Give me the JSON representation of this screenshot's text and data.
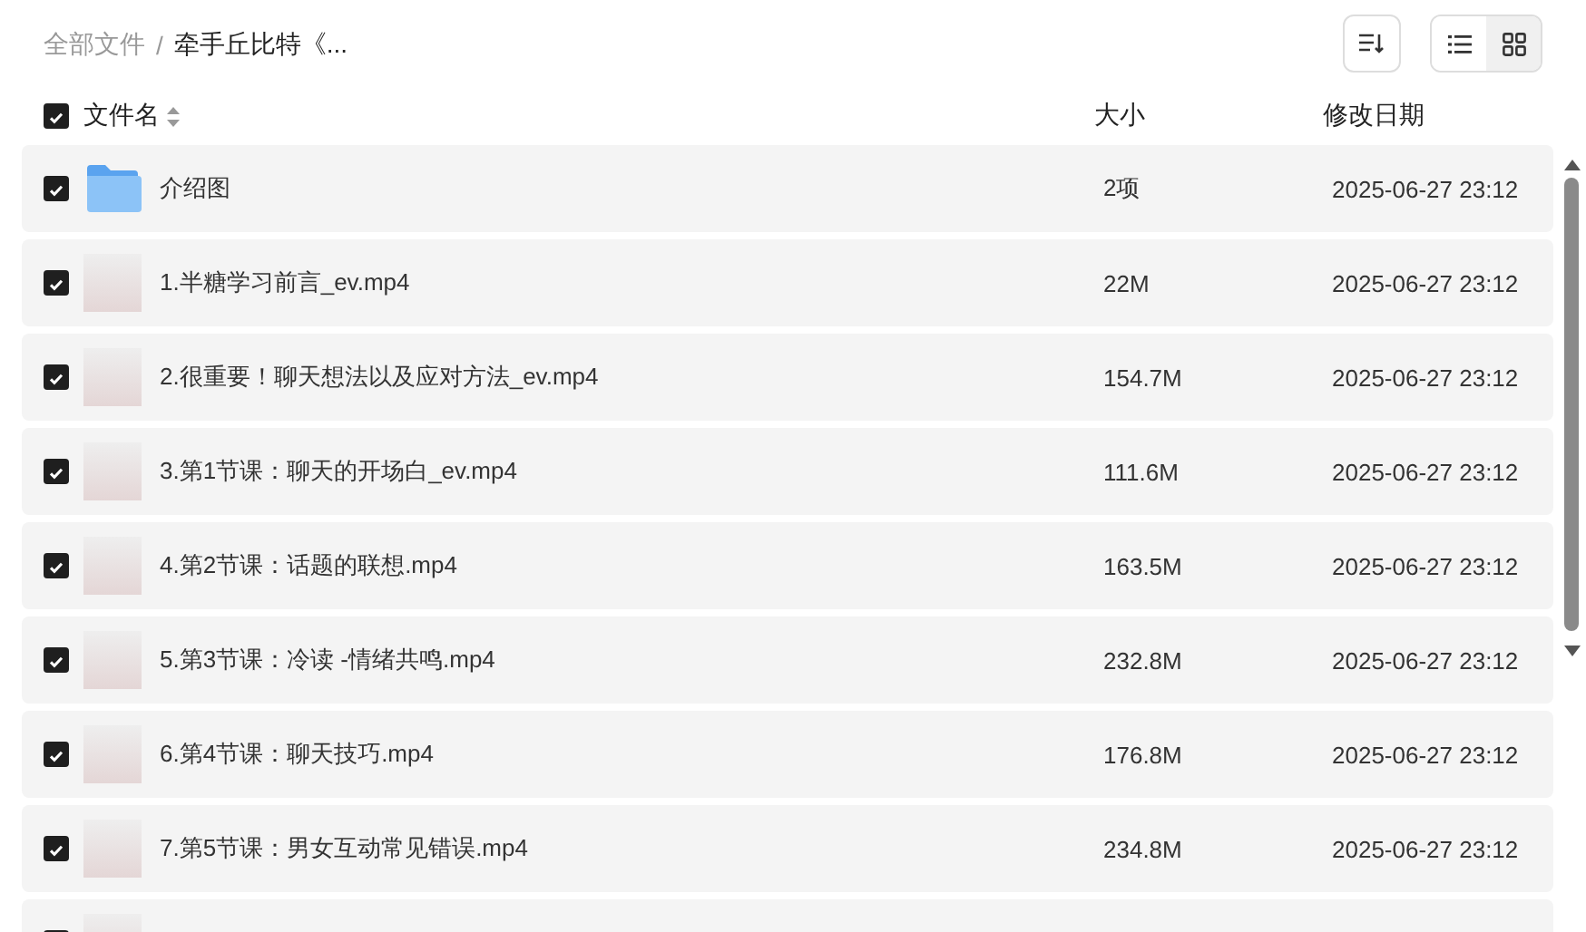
{
  "breadcrumb_separator": "/",
  "breadcrumb": [
    {
      "label": "全部文件",
      "current": false
    },
    {
      "label": "牵手丘比特《...",
      "current": true
    }
  ],
  "view_modes": [
    {
      "kind": "list",
      "selected": true
    },
    {
      "kind": "grid",
      "selected": false
    }
  ],
  "header": {
    "select_all_checked": true,
    "columns": [
      "文件名",
      "大小",
      "修改日期"
    ]
  },
  "files": [
    {
      "kind": "folder",
      "checked": true,
      "name": "介绍图",
      "size": "2项",
      "modified": "2025-06-27 23:12"
    },
    {
      "kind": "video",
      "checked": true,
      "name": "1.半糖学习前言_ev.mp4",
      "size": "22M",
      "modified": "2025-06-27 23:12"
    },
    {
      "kind": "video",
      "checked": true,
      "name": "2.很重要！聊天想法以及应对方法_ev.mp4",
      "size": "154.7M",
      "modified": "2025-06-27 23:12"
    },
    {
      "kind": "video",
      "checked": true,
      "name": "3.第1节课：聊天的开场白_ev.mp4",
      "size": "111.6M",
      "modified": "2025-06-27 23:12"
    },
    {
      "kind": "video",
      "checked": true,
      "name": "4.第2节课：话题的联想.mp4",
      "size": "163.5M",
      "modified": "2025-06-27 23:12"
    },
    {
      "kind": "video",
      "checked": true,
      "name": "5.第3节课：冷读 -情绪共鸣.mp4",
      "size": "232.8M",
      "modified": "2025-06-27 23:12"
    },
    {
      "kind": "video",
      "checked": true,
      "name": "6.第4节课：聊天技巧.mp4",
      "size": "176.8M",
      "modified": "2025-06-27 23:12"
    },
    {
      "kind": "video",
      "checked": true,
      "name": "7.第5节课：男女互动常见错误.mp4",
      "size": "234.8M",
      "modified": "2025-06-27 23:12"
    },
    {
      "kind": "video",
      "checked": true
    }
  ]
}
